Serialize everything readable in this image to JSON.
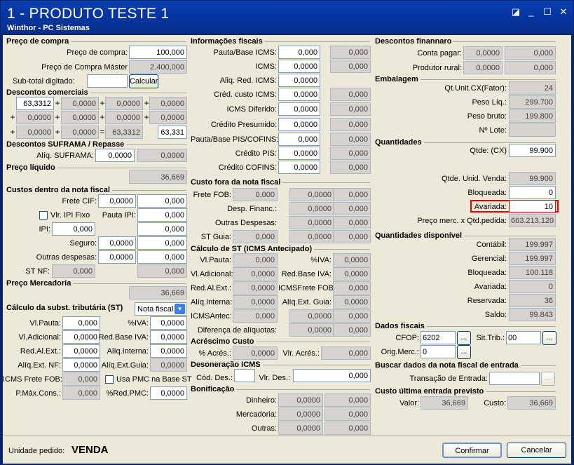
{
  "window": {
    "title": "1 - PRODUTO TESTE 1",
    "subtitle": "Winthor - PC Sistemas"
  },
  "preco_compra": {
    "header": "Preço de compra",
    "preco_label": "Preço de compra:",
    "preco_value": "100,000",
    "master_label": "Preço de Compra Máster",
    "master_value": "2.400,000",
    "subtotal_label": "Sub-total digitado:",
    "subtotal_value": "",
    "calcular": "Calcular"
  },
  "descontos_comerciais": {
    "header": "Descontos comerciais",
    "rows": [
      [
        "63,3312",
        "0,0000",
        "0,0000",
        "0,0000"
      ],
      [
        "0,0000",
        "0,0000",
        "0,0000",
        "0,0000"
      ],
      [
        "0,0000",
        "0,0000",
        "63,3312",
        "63,331"
      ]
    ]
  },
  "suframa": {
    "header": "Descontos SUFRAMA / Repasse",
    "aliq_label": "Alíq. SUFRAMA:",
    "aliq_value": "0,0000",
    "aliq_value2": "0,0000"
  },
  "preco_liquido": {
    "header": "Preço líquido",
    "value": "36,669"
  },
  "custos_nf": {
    "header": "Custos dentro da nota fiscal",
    "frete_label": "Frete CIF:",
    "frete_v1": "0,0000",
    "frete_v2": "0,000",
    "ipi_fixo_label": "Vlr. IPI Fixo",
    "pauta_ipi_label": "Pauta IPI:",
    "pauta_ipi_value": "0,000",
    "ipi_label": "IPI:",
    "ipi_v1": "0,000",
    "ipi_v2": "0,000",
    "seguro_label": "Seguro:",
    "seguro_v1": "0,0000",
    "seguro_v2": "0,000",
    "outras_label": "Outras despesas:",
    "outras_v1": "0,0000",
    "outras_v2": "0,000",
    "stnf_label": "ST NF:",
    "stnf_v1": "0,000",
    "stnf_v2": "0,000"
  },
  "preco_mercadoria": {
    "header": "Preço Mercadoria",
    "value": "36,669"
  },
  "calc_st": {
    "header": "Cálculo da subst. tributária (ST)",
    "select": "Nota fiscal",
    "vlpauta_label": "Vl.Pauta:",
    "vlpauta": "0,000",
    "iva_label": "%IVA:",
    "iva": "0,0000",
    "vladic_label": "Vl.Adicional:",
    "vladic": "0,0000",
    "redbase_label": "Red.Base IVA:",
    "redbase": "0,0000",
    "redalext_label": "Red.Al.Ext.:",
    "redalext": "0,0000",
    "aliqint_label": "Alíq.Interna:",
    "aliqint": "0,0000",
    "aliqextnf_label": "Alíq.Ext. NF:",
    "aliqextnf": "0,0000",
    "aliqextguia_label": "Alíq.Ext.Guia:",
    "aliqextguia": "0,0000",
    "icmsfrete_label": "ICMS Frete FOB:",
    "icmsfrete": "0,000",
    "usapmc_label": "Usa PMC na Base ST",
    "pmax_label": "P.Máx.Cons.:",
    "pmax": "0,000",
    "redpmc_label": "%Red.PMC:",
    "redpmc": "0,0000"
  },
  "info_fiscais": {
    "header": "Informações fiscais",
    "rows": [
      {
        "label": "Pauta/Base ICMS:",
        "v1": "0,000",
        "v2": "0,000"
      },
      {
        "label": "ICMS:",
        "v1": "0,0000",
        "v2": "0,000"
      },
      {
        "label": "Aliq. Red. ICMS:",
        "v1": "0,0000",
        "v2": ""
      },
      {
        "label": "Créd. custo ICMS:",
        "v1": "0,0000",
        "v2": "0,000"
      },
      {
        "label": "ICMS Diferido:",
        "v1": "0,0000",
        "v2": "0,000"
      },
      {
        "label": "Crédito Presumido:",
        "v1": "0,0000",
        "v2": "0,000"
      },
      {
        "label": "Pauta/Base PIS/COFINS:",
        "v1": "0,000",
        "v2": "0,000"
      },
      {
        "label": "Crédito PIS:",
        "v1": "0,0000",
        "v2": "0,000"
      },
      {
        "label": "Crédito COFINS:",
        "v1": "0,0000",
        "v2": "0,000"
      }
    ]
  },
  "custo_fora": {
    "header": "Custo fora da nota fiscal",
    "frete_label": "Frete FOB:",
    "frete_v1": "0,000",
    "frete_v2": "0,0000",
    "frete_v3": "0,000",
    "desp_label": "Desp. Financ.:",
    "desp_v1": "0,0000",
    "desp_v2": "0,000",
    "outras_label": "Outras Despesas:",
    "outras_v1": "0,0000",
    "outras_v2": "0,000",
    "stguia_label": "ST Guia:",
    "stguia_v1": "0,000",
    "stguia_v2": "0,0000",
    "stguia_v3": "0,000"
  },
  "calc_st_antecipado": {
    "header": "Cálculo de ST (ICMS Antecipado)",
    "vlpauta_label": "Vl.Pauta:",
    "vlpauta": "0,000",
    "iva_label": "%IVA:",
    "iva": "0,0000",
    "vladic_label": "Vl.Adicional:",
    "vladic": "0,0000",
    "redbase_label": "Red.Base IVA:",
    "redbase": "0,0000",
    "redalext_label": "Red.Al.Ext.:",
    "redalext": "0,0000",
    "icmsfrete_label": "ICMSFrete FOB:",
    "icmsfrete": "0,000",
    "aliqint_label": "Alíq.Interna:",
    "aliqint": "0,0000",
    "aliqextguia_label": "Alíq.Ext. Guia:",
    "aliqextguia": "0,0000",
    "icmsantec_label": "ICMSAntec:",
    "icmsantec_v1": "0,000",
    "icmsantec_v2": "0,0000",
    "icmsantec_v3": "0,000",
    "dif_label": "Diferença de alíquotas:",
    "dif_v1": "0,0000",
    "dif_v2": "0,000"
  },
  "acrescimo": {
    "header": "Acréscimo Custo",
    "acres_label": "% Acrés.:",
    "acres": "0,0000",
    "vlr_label": "Vlr. Acrés.:",
    "vlr": "0,000"
  },
  "desoneracao": {
    "header": "Desoneração ICMS",
    "cod_label": "Cód. Des.:",
    "cod": "",
    "vlr_label": "Vlr. Des.:",
    "vlr": "0,000"
  },
  "bonificacao": {
    "header": "Bonificação",
    "dinheiro_label": "Dinheiro:",
    "dinheiro_v1": "0,0000",
    "dinheiro_v2": "0,000",
    "mercadoria_label": "Mercadoria:",
    "mercadoria_v1": "0,0000",
    "mercadoria_v2": "0,000",
    "outras_label": "Outras:",
    "outras_v1": "0,0000",
    "outras_v2": "0,000"
  },
  "desc_financeiro": {
    "header": "Descontos finannaro",
    "pagar_label": "Conta pagar:",
    "pagar_v1": "0,0000",
    "pagar_v2": "0,000",
    "rural_label": "Produtor rural:",
    "rural_v1": "0,0000",
    "rural_v2": "0,000"
  },
  "embalagem": {
    "header": "Embalagem",
    "qtunit_label": "Qt.Unit.CX(Fator):",
    "qtunit": "24",
    "pesoliq_label": "Peso Líq.:",
    "pesoliq": "299.700",
    "pesobruto_label": "Peso bruto:",
    "pesobruto": "199.800",
    "lote_label": "Nº Lote:",
    "lote": ""
  },
  "quantidades": {
    "header": "Quantidades",
    "qtde_label": "Qtde: (CX)",
    "qtde": "99.900",
    "qtdeunid_label": "Qtde. Unid. Venda:",
    "qtdeunid": "99.900",
    "bloqueada_label": "Bloqueada:",
    "bloqueada": "0",
    "avariada_label": "Avariada:",
    "avariada": "10",
    "precomerc_label": "Preço merc. x Qtd.pedida:",
    "precomerc": "663.213,120"
  },
  "quant_disp": {
    "header": "Quantidades disponível",
    "contabil_label": "Contábil:",
    "contabil": "199.997",
    "gerencial_label": "Gerencial:",
    "gerencial": "199.997",
    "bloqueada_label": "Bloqueada:",
    "bloqueada": "100.118",
    "avariada_label": "Avariada:",
    "avariada": "0",
    "reservada_label": "Reservada:",
    "reservada": "36",
    "saldo_label": "Saldo:",
    "saldo": "99.843"
  },
  "dados_fiscais": {
    "header": "Dados fiscais",
    "cfop_label": "CFOP:",
    "cfop": "6202",
    "sittrib_label": "Sit.Trib.:",
    "sittrib": "00",
    "origmerc_label": "Orig.Merc.:",
    "origmerc": "0",
    "dots": "..."
  },
  "buscar_nf": {
    "header": "Buscar dados da nota fiscal de entrada",
    "transacao_label": "Transação de Entrada:",
    "transacao": ""
  },
  "custo_ultima": {
    "header": "Custo última entrada previsto",
    "valor_label": "Valor:",
    "valor": "36,669",
    "custo_label": "Custo:",
    "custo": "36,669"
  },
  "footer": {
    "unidade_label": "Unidade pedido:",
    "unidade_value": "VENDA",
    "confirmar": "Confirmar",
    "cancelar": "Cancelar"
  }
}
